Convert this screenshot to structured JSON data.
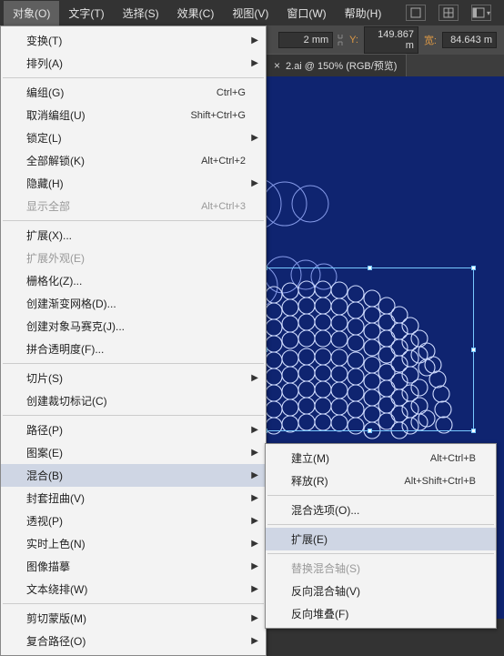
{
  "menubar": {
    "items": [
      {
        "label": "对象(O)",
        "active": true
      },
      {
        "label": "文字(T)",
        "active": false
      },
      {
        "label": "选择(S)",
        "active": false
      },
      {
        "label": "效果(C)",
        "active": false
      },
      {
        "label": "视图(V)",
        "active": false
      },
      {
        "label": "窗口(W)",
        "active": false
      },
      {
        "label": "帮助(H)",
        "active": false
      }
    ]
  },
  "toolbar": {
    "x_suffix": "2 mm",
    "y_label": "Y:",
    "y_value": "149.867 m",
    "w_label": "宽:",
    "w_value": "84.643 m"
  },
  "tab": {
    "name": "2.ai @ 150% (RGB/预览)",
    "close": "×"
  },
  "menu_object": {
    "groups": [
      [
        {
          "label": "变换(T)",
          "submenu": true
        },
        {
          "label": "排列(A)",
          "submenu": true
        }
      ],
      [
        {
          "label": "编组(G)",
          "shortcut": "Ctrl+G"
        },
        {
          "label": "取消编组(U)",
          "shortcut": "Shift+Ctrl+G"
        },
        {
          "label": "锁定(L)",
          "submenu": true
        },
        {
          "label": "全部解锁(K)",
          "shortcut": "Alt+Ctrl+2"
        },
        {
          "label": "隐藏(H)",
          "submenu": true
        },
        {
          "label": "显示全部",
          "shortcut": "Alt+Ctrl+3",
          "disabled": true
        }
      ],
      [
        {
          "label": "扩展(X)..."
        },
        {
          "label": "扩展外观(E)",
          "disabled": true
        },
        {
          "label": "栅格化(Z)..."
        },
        {
          "label": "创建渐变网格(D)..."
        },
        {
          "label": "创建对象马赛克(J)..."
        },
        {
          "label": "拼合透明度(F)..."
        }
      ],
      [
        {
          "label": "切片(S)",
          "submenu": true
        },
        {
          "label": "创建裁切标记(C)"
        }
      ],
      [
        {
          "label": "路径(P)",
          "submenu": true
        },
        {
          "label": "图案(E)",
          "submenu": true
        },
        {
          "label": "混合(B)",
          "submenu": true,
          "hl": true
        },
        {
          "label": "封套扭曲(V)",
          "submenu": true
        },
        {
          "label": "透视(P)",
          "submenu": true
        },
        {
          "label": "实时上色(N)",
          "submenu": true
        },
        {
          "label": "图像描摹",
          "submenu": true
        },
        {
          "label": "文本绕排(W)",
          "submenu": true
        }
      ],
      [
        {
          "label": "剪切蒙版(M)",
          "submenu": true
        },
        {
          "label": "复合路径(O)",
          "submenu": true
        }
      ]
    ]
  },
  "menu_blend": {
    "groups": [
      [
        {
          "label": "建立(M)",
          "shortcut": "Alt+Ctrl+B"
        },
        {
          "label": "释放(R)",
          "shortcut": "Alt+Shift+Ctrl+B"
        }
      ],
      [
        {
          "label": "混合选项(O)..."
        }
      ],
      [
        {
          "label": "扩展(E)",
          "hl": true
        }
      ],
      [
        {
          "label": "替换混合轴(S)",
          "disabled": true
        },
        {
          "label": "反向混合轴(V)"
        },
        {
          "label": "反向堆叠(F)"
        }
      ]
    ]
  }
}
